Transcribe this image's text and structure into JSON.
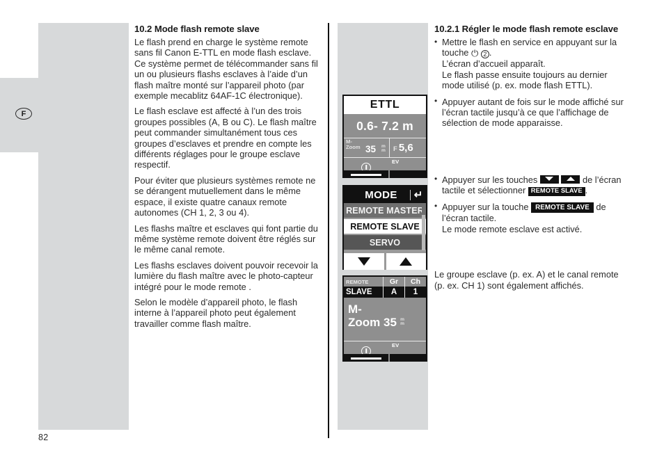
{
  "page": {
    "number": "82",
    "language_badge": "F"
  },
  "left_column": {
    "heading": "10.2 Mode flash remote slave",
    "paragraphs": [
      "Le flash prend en charge le système remote sans fil Canon E-TTL en mode flash esclave. Ce système permet de télécommander sans fil un ou plusieurs flashs esclaves à l’aide d’un flash maître monté sur l’appareil photo (par exemple mecablitz 64AF-1C électronique).",
      "Le flash esclave est affecté à l’un des trois groupes possibles (A, B ou C). Le flash maître peut commander simultanément tous ces groupes d’esclaves et prendre en compte les différents réglages pour le groupe esclave respectif.",
      "Pour éviter que plusieurs systèmes remote ne se dérangent mutuellement dans le même espace, il existe quatre canaux remote autonomes (CH 1, 2, 3 ou 4).",
      "Les flashs maître et esclaves qui font partie du même système remote doivent être réglés sur le même canal remote.",
      "Les flashs esclaves doivent pouvoir recevoir la lumière du flash maître avec le photo-capteur intégré pour le mode remote .",
      "Selon le modèle d’appareil photo, le flash interne à l’appareil photo peut également travailler comme flash maître."
    ]
  },
  "right_column": {
    "heading": "10.2.1 Régler le mode flash remote esclave",
    "bullet_1": {
      "text_before_icon": "Mettre le flash en service en appuyant sur la touche",
      "power_icon": "power-icon",
      "step_number": "2",
      "text_after": ".",
      "line_2": "L’écran d’accueil apparaît.",
      "line_3": "Le flash passe ensuite toujours au dernier mode utilisé (p. ex. mode flash ETTL)."
    },
    "bullet_2": {
      "text": "Appuyer autant de fois sur le mode affiché sur l’écran tactile jusqu’à ce que l’affichage de sélection de mode apparaisse."
    },
    "bullet_3": {
      "text_before": "Appuyer sur les touches",
      "icon_down": "arrow-down-key-icon",
      "icon_up": "arrow-up-key-icon",
      "text_middle": "de l’écran tactile et sélectionner",
      "badge": "REMOTE SLAVE",
      "text_after": "."
    },
    "bullet_4": {
      "text_before": "Appuyer sur la touche",
      "badge": "REMOTE SLAVE",
      "text_after": "de l’écran tactile.",
      "line_2": "Le mode remote esclave est activé."
    },
    "closing_paragraph": "Le groupe esclave (p. ex. A) et le canal remote (p. ex. CH 1) sont également affichés."
  },
  "lcd_panels": [
    {
      "id": "panel-ettl",
      "mode_label": "ETTL",
      "distance": "0.6- 7.2 m",
      "zoom_label": "M-\nZoom",
      "zoom_label_line1": "M-",
      "zoom_label_line2": "Zoom",
      "zoom_value": "35",
      "zoom_unit_line1": "m",
      "zoom_unit_line2": "m",
      "aperture_label": "F",
      "aperture_value": "5,6",
      "info_icon": "info-icon",
      "ev_label": "EV"
    },
    {
      "id": "panel-mode",
      "title": "MODE",
      "back_icon": "back-arrow-icon",
      "items": [
        {
          "label": "REMOTE MASTER",
          "state": "dim"
        },
        {
          "label": "REMOTE SLAVE",
          "state": "selected"
        },
        {
          "label": "SERVO",
          "state": "dim2"
        }
      ],
      "button_down": "arrow-down-icon",
      "button_up": "arrow-up-icon"
    },
    {
      "id": "panel-remote-slave",
      "header_remote": "REMOTE",
      "header_gr": "Gr",
      "header_ch": "Ch",
      "value_slave": "SLAVE",
      "value_gr": "A",
      "value_ch": "1",
      "zoom_label_line1": "M-",
      "zoom_label_line2": "Zoom",
      "zoom_value": "35",
      "zoom_unit_line1": "m",
      "zoom_unit_line2": "m",
      "info_icon": "info-icon",
      "ev_label": "EV"
    }
  ]
}
